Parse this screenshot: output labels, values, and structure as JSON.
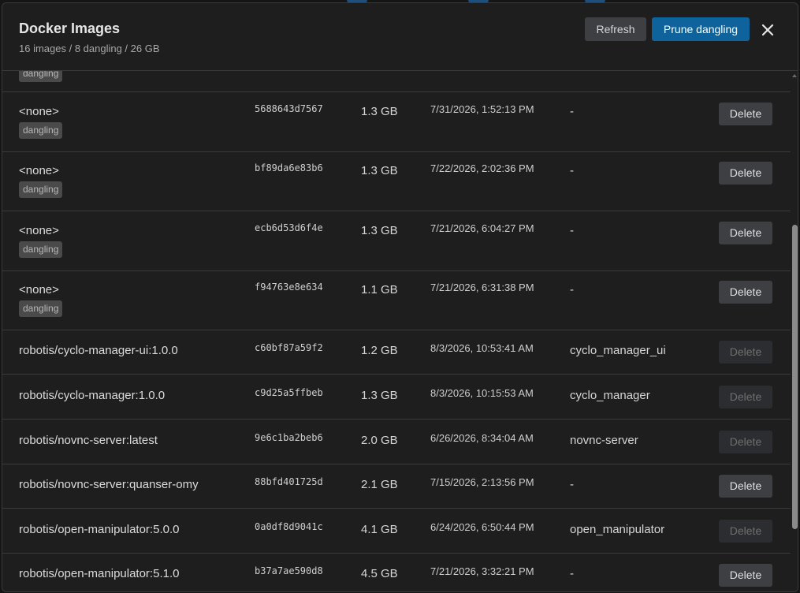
{
  "header": {
    "title": "Docker Images",
    "subtitle": "16 images / 8 dangling / 26 GB",
    "refresh_label": "Refresh",
    "prune_label": "Prune dangling"
  },
  "partial_row": {
    "badge": "dangling"
  },
  "rows": [
    {
      "name": "<none>",
      "badge": "dangling",
      "id": "5688643d7567",
      "size": "1.3 GB",
      "created": "7/31/2026, 1:52:13 PM",
      "container": "-",
      "delete_label": "Delete",
      "delete_enabled": true
    },
    {
      "name": "<none>",
      "badge": "dangling",
      "id": "bf89da6e83b6",
      "size": "1.3 GB",
      "created": "7/22/2026, 2:02:36 PM",
      "container": "-",
      "delete_label": "Delete",
      "delete_enabled": true
    },
    {
      "name": "<none>",
      "badge": "dangling",
      "id": "ecb6d53d6f4e",
      "size": "1.3 GB",
      "created": "7/21/2026, 6:04:27 PM",
      "container": "-",
      "delete_label": "Delete",
      "delete_enabled": true
    },
    {
      "name": "<none>",
      "badge": "dangling",
      "id": "f94763e8e634",
      "size": "1.1 GB",
      "created": "7/21/2026, 6:31:38 PM",
      "container": "-",
      "delete_label": "Delete",
      "delete_enabled": true
    },
    {
      "name": "robotis/cyclo-manager-ui:1.0.0",
      "id": "c60bf87a59f2",
      "size": "1.2 GB",
      "created": "8/3/2026, 10:53:41 AM",
      "container": "cyclo_manager_ui",
      "delete_label": "Delete",
      "delete_enabled": false
    },
    {
      "name": "robotis/cyclo-manager:1.0.0",
      "id": "c9d25a5ffbeb",
      "size": "1.3 GB",
      "created": "8/3/2026, 10:15:53 AM",
      "container": "cyclo_manager",
      "delete_label": "Delete",
      "delete_enabled": false
    },
    {
      "name": "robotis/novnc-server:latest",
      "id": "9e6c1ba2beb6",
      "size": "2.0 GB",
      "created": "6/26/2026, 8:34:04 AM",
      "container": "novnc-server",
      "delete_label": "Delete",
      "delete_enabled": false
    },
    {
      "name": "robotis/novnc-server:quanser-omy",
      "id": "88bfd401725d",
      "size": "2.1 GB",
      "created": "7/15/2026, 2:13:56 PM",
      "container": "-",
      "delete_label": "Delete",
      "delete_enabled": true
    },
    {
      "name": "robotis/open-manipulator:5.0.0",
      "id": "0a0df8d9041c",
      "size": "4.1 GB",
      "created": "6/24/2026, 6:50:44 PM",
      "container": "open_manipulator",
      "delete_label": "Delete",
      "delete_enabled": false
    },
    {
      "name": "robotis/open-manipulator:5.1.0",
      "id": "b37a7ae590d8",
      "size": "4.5 GB",
      "created": "7/21/2026, 3:32:21 PM",
      "container": "-",
      "delete_label": "Delete",
      "delete_enabled": true
    }
  ]
}
